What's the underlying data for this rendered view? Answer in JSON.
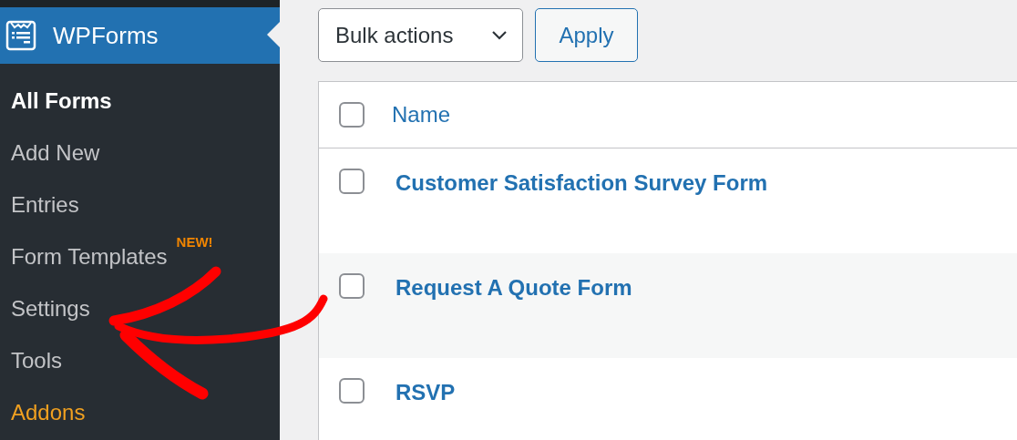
{
  "sidebar": {
    "title": "WPForms",
    "items": [
      {
        "label": "All Forms",
        "selected": true,
        "accent": false
      },
      {
        "label": "Add New",
        "selected": false,
        "accent": false
      },
      {
        "label": "Entries",
        "selected": false,
        "accent": false
      },
      {
        "label": "Form Templates",
        "selected": false,
        "accent": false,
        "badge": "NEW!"
      },
      {
        "label": "Settings",
        "selected": false,
        "accent": false
      },
      {
        "label": "Tools",
        "selected": false,
        "accent": false
      },
      {
        "label": "Addons",
        "selected": false,
        "accent": true
      }
    ]
  },
  "toolbar": {
    "bulk_actions": "Bulk actions",
    "apply": "Apply"
  },
  "table": {
    "select_all": {
      "checked": false
    },
    "columns": [
      "Name"
    ],
    "rows": [
      {
        "name": "Customer Satisfaction Survey Form",
        "checked": false
      },
      {
        "name": "Request A Quote Form",
        "checked": false
      },
      {
        "name": "RSVP",
        "checked": false
      }
    ]
  }
}
